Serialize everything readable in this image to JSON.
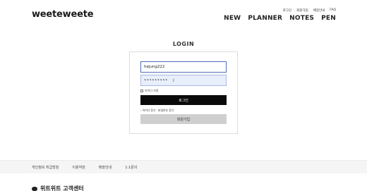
{
  "header": {
    "logo": "weeteweete",
    "util_nav": [
      "로그인",
      "회원가입",
      "매장안내",
      "FAQ"
    ],
    "main_nav": [
      "NEW",
      "PLANNER",
      "NOTES",
      "PEN"
    ]
  },
  "login": {
    "title": "LOGIN",
    "username_value": "hejung222",
    "password_value": "•••••••••",
    "remember_label": "아이디 저장",
    "login_button": "로그인",
    "find_links": "› 아이디 찾기 · 비밀번호 찾기",
    "join_button": "회원가입"
  },
  "footer": {
    "links": [
      "개인정보 취급방침",
      "이용약관",
      "매장안내",
      "1:1문의"
    ],
    "cs_title": "위트위트 고객센터"
  }
}
